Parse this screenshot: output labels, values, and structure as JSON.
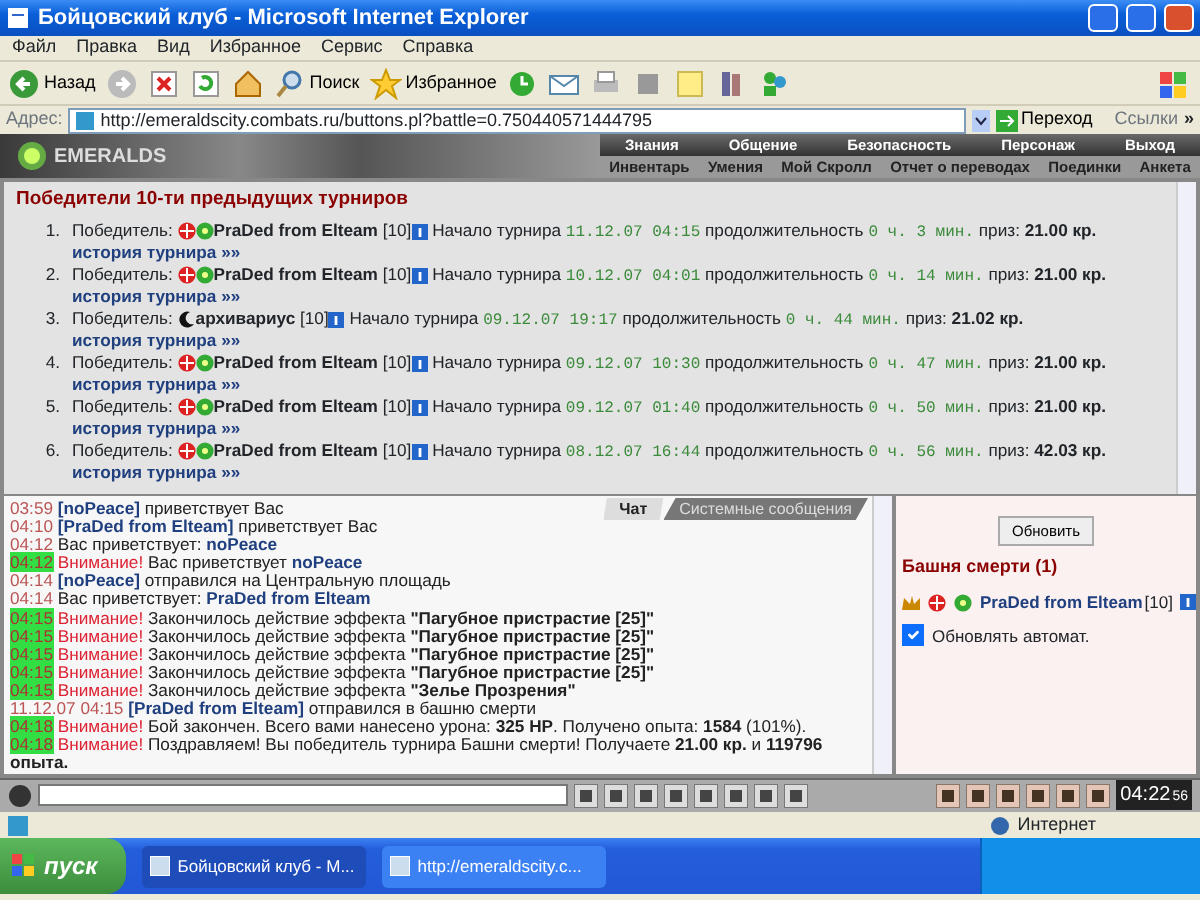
{
  "window": {
    "title": "Бойцовский клуб - Microsoft Internet Explorer"
  },
  "menu": [
    "Файл",
    "Правка",
    "Вид",
    "Избранное",
    "Сервис",
    "Справка"
  ],
  "toolbar": [
    {
      "kind": "back",
      "label": "Назад"
    },
    {
      "kind": "forward"
    },
    {
      "kind": "stop"
    },
    {
      "kind": "refresh"
    },
    {
      "kind": "home"
    },
    {
      "kind": "search",
      "label": "Поиск"
    },
    {
      "kind": "favorites",
      "label": "Избранное"
    },
    {
      "kind": "history"
    },
    {
      "kind": "mail"
    },
    {
      "kind": "print"
    },
    {
      "kind": "edit"
    },
    {
      "kind": "note"
    },
    {
      "kind": "research"
    },
    {
      "kind": "messenger"
    }
  ],
  "address": {
    "label": "Адрес:",
    "url": "http://emeraldscity.combats.ru/buttons.pl?battle=0.750440571444795",
    "go": "Переход",
    "links": "Ссылки",
    "more": "»"
  },
  "game_header": {
    "logo": "EMERALDS",
    "nav": [
      "Знания",
      "Общение",
      "Безопасность",
      "Персонаж",
      "Выход"
    ],
    "subnav": [
      "Инвентарь",
      "Умения",
      "Мой Скролл",
      "Отчет о переводах",
      "Поединки",
      "Анкета"
    ]
  },
  "winners": {
    "heading": "Победители 10-ти предыдущих турниров",
    "items": [
      {
        "num": "1.",
        "winner_label": "Победитель:",
        "kind": "clan",
        "name": "PraDed from Elteam",
        "level": "[10]",
        "start_label": "Начало турнира",
        "start": "11.12.07 04:15",
        "duration_label": "продолжительность",
        "duration": "0 ч. 3 мин.",
        "prize_label": "приз:",
        "prize": "21.00 кр.",
        "link": "история турнира »»"
      },
      {
        "num": "2.",
        "winner_label": "Победитель:",
        "kind": "clan",
        "name": "PraDed from Elteam",
        "level": "[10]",
        "start_label": "Начало турнира",
        "start": "10.12.07 04:01",
        "duration_label": "продолжительность",
        "duration": "0 ч. 14 мин.",
        "prize_label": "приз:",
        "prize": "21.00 кр.",
        "link": "история турнира »»"
      },
      {
        "num": "3.",
        "winner_label": "Победитель:",
        "kind": "archivist",
        "name": "архивариус",
        "level": "[10]",
        "start_label": "Начало турнира",
        "start": "09.12.07 19:17",
        "duration_label": "продолжительность",
        "duration": "0 ч. 44 мин.",
        "prize_label": "приз:",
        "prize": "21.02 кр.",
        "link": "история турнира »»"
      },
      {
        "num": "4.",
        "winner_label": "Победитель:",
        "kind": "clan",
        "name": "PraDed from Elteam",
        "level": "[10]",
        "start_label": "Начало турнира",
        "start": "09.12.07 10:30",
        "duration_label": "продолжительность",
        "duration": "0 ч. 47 мин.",
        "prize_label": "приз:",
        "prize": "21.00 кр.",
        "link": "история турнира »»"
      },
      {
        "num": "5.",
        "winner_label": "Победитель:",
        "kind": "clan",
        "name": "PraDed from Elteam",
        "level": "[10]",
        "start_label": "Начало турнира",
        "start": "09.12.07 01:40",
        "duration_label": "продолжительность",
        "duration": "0 ч. 50 мин.",
        "prize_label": "приз:",
        "prize": "21.00 кр.",
        "link": "история турнира »»"
      },
      {
        "num": "6.",
        "winner_label": "Победитель:",
        "kind": "clan",
        "name": "PraDed from Elteam",
        "level": "[10]",
        "start_label": "Начало турнира",
        "start": "08.12.07 16:44",
        "duration_label": "продолжительность",
        "duration": "0 ч. 56 мин.",
        "prize_label": "приз:",
        "prize": "42.03 кр.",
        "link": "история турнира »»"
      }
    ]
  },
  "chat": {
    "tabs": [
      {
        "label": "Чат",
        "selected": true
      },
      {
        "label": "Системные сообщения",
        "selected": false
      }
    ],
    "messages": [
      {
        "time": "03:59",
        "highlight": false,
        "parts": [
          {
            "kind": "nick",
            "text": "[noPeace]"
          },
          {
            "kind": "text",
            "text": " приветствует Вас"
          }
        ]
      },
      {
        "time": "04:10",
        "highlight": false,
        "parts": [
          {
            "kind": "nick",
            "text": "[PraDed from Elteam]"
          },
          {
            "kind": "text",
            "text": " приветствует Вас"
          }
        ]
      },
      {
        "time": "04:12",
        "highlight": false,
        "parts": [
          {
            "kind": "text",
            "text": "Вас приветствует: "
          },
          {
            "kind": "nick",
            "text": "noPeace"
          }
        ]
      },
      {
        "time": "04:12",
        "highlight": true,
        "parts": [
          {
            "kind": "alert",
            "text": "Внимание!"
          },
          {
            "kind": "text",
            "text": " Вас приветствует "
          },
          {
            "kind": "nick",
            "text": "noPeace"
          }
        ]
      },
      {
        "time": "04:14",
        "highlight": false,
        "parts": [
          {
            "kind": "nick",
            "text": "[noPeace]"
          },
          {
            "kind": "text",
            "text": " отправился на Центральную площадь"
          }
        ]
      },
      {
        "time": "04:14",
        "highlight": false,
        "parts": [
          {
            "kind": "text",
            "text": "Вас приветствует: "
          },
          {
            "kind": "nick",
            "text": "PraDed from Elteam"
          }
        ]
      },
      {
        "time": "04:15",
        "highlight": true,
        "parts": [
          {
            "kind": "alert",
            "text": "Внимание!"
          },
          {
            "kind": "text",
            "text": " Закончилось действие эффекта "
          },
          {
            "kind": "bold",
            "text": "\"Пагубное пристрастие [25]\""
          }
        ]
      },
      {
        "time": "04:15",
        "highlight": true,
        "parts": [
          {
            "kind": "alert",
            "text": "Внимание!"
          },
          {
            "kind": "text",
            "text": " Закончилось действие эффекта "
          },
          {
            "kind": "bold",
            "text": "\"Пагубное пристрастие [25]\""
          }
        ]
      },
      {
        "time": "04:15",
        "highlight": true,
        "parts": [
          {
            "kind": "alert",
            "text": "Внимание!"
          },
          {
            "kind": "text",
            "text": " Закончилось действие эффекта "
          },
          {
            "kind": "bold",
            "text": "\"Пагубное пристрастие [25]\""
          }
        ]
      },
      {
        "time": "04:15",
        "highlight": true,
        "parts": [
          {
            "kind": "alert",
            "text": "Внимание!"
          },
          {
            "kind": "text",
            "text": " Закончилось действие эффекта "
          },
          {
            "kind": "bold",
            "text": "\"Пагубное пристрастие [25]\""
          }
        ]
      },
      {
        "time": "04:15",
        "highlight": true,
        "parts": [
          {
            "kind": "alert",
            "text": "Внимание!"
          },
          {
            "kind": "text",
            "text": " Закончилось действие эффекта "
          },
          {
            "kind": "bold",
            "text": "\"Зелье Прозрения\""
          }
        ]
      },
      {
        "time": "11.12.07 04:15",
        "highlight": false,
        "parts": [
          {
            "kind": "nick",
            "text": "[PraDed from Elteam]"
          },
          {
            "kind": "text",
            "text": " отправился в башню смерти"
          }
        ]
      },
      {
        "time": "04:18",
        "highlight": true,
        "parts": [
          {
            "kind": "alert",
            "text": "Внимание!"
          },
          {
            "kind": "text",
            "text": " Бой закончен. Всего вами нанесено урона: "
          },
          {
            "kind": "bold",
            "text": "325 HP"
          },
          {
            "kind": "text",
            "text": ". Получено опыта: "
          },
          {
            "kind": "bold",
            "text": "1584"
          },
          {
            "kind": "text",
            "text": " (101%)."
          }
        ]
      },
      {
        "time": "04:18",
        "highlight": true,
        "parts": [
          {
            "kind": "alert",
            "text": "Внимание!"
          },
          {
            "kind": "text",
            "text": " Поздравляем! Вы победитель турнира Башни смерти! Получаете "
          },
          {
            "kind": "bold",
            "text": "21.00 кр."
          },
          {
            "kind": "text",
            "text": " и "
          },
          {
            "kind": "bold",
            "text": "119796 опыта."
          }
        ]
      }
    ]
  },
  "side_panel": {
    "button": "Обновить",
    "title": "Башня смерти (1)",
    "player": {
      "name": "PraDed from Elteam",
      "level": "[10]"
    },
    "auto_refresh": {
      "label": "Обновлять автомат.",
      "checked": true
    }
  },
  "game_bar": {
    "clock": "04:22",
    "seconds": "56"
  },
  "status_bar": {
    "zone": "Интернет"
  },
  "taskbar": {
    "start": "пуск",
    "tasks": [
      {
        "label": "Бойцовский клуб - M...",
        "selected": true
      },
      {
        "label": "http://emeraldscity.c...",
        "selected": false
      }
    ]
  }
}
